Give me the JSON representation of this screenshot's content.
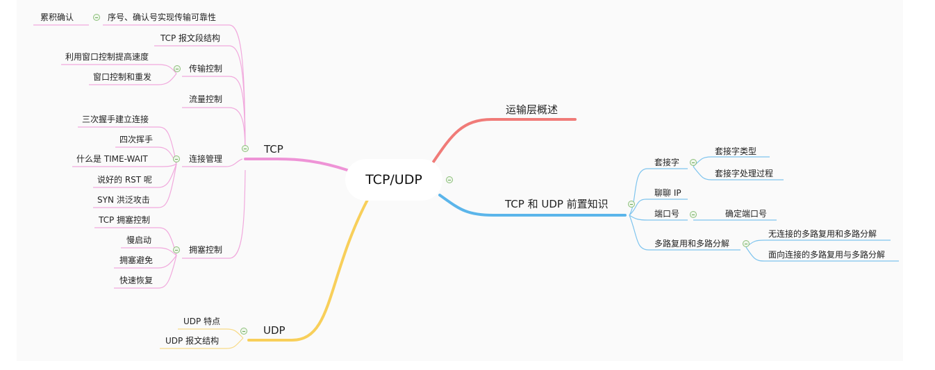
{
  "root": {
    "label": "TCP/UDP"
  },
  "branches": {
    "overview": {
      "label": "运输层概述",
      "color": "#f07b78"
    },
    "prereq": {
      "label": "TCP 和 UDP 前置知识",
      "color": "#5bb5ea",
      "socket": {
        "label": "套接字",
        "children": [
          "套接字类型",
          "套接字处理过程"
        ]
      },
      "ip": {
        "label": "聊聊 IP"
      },
      "port": {
        "label": "端口号",
        "children": [
          "确定端口号"
        ]
      },
      "mux": {
        "label": "多路复用和多路分解",
        "children": [
          "无连接的多路复用和多路分解",
          "面向连接的多路复用与多路分解"
        ]
      }
    },
    "tcp": {
      "label": "TCP",
      "color": "#ee93d6",
      "reliability": {
        "label": "序号、确认号实现传输可靠性",
        "children": [
          "累积确认"
        ]
      },
      "segment": {
        "label": "TCP 报文段结构"
      },
      "transmission": {
        "label": "传输控制",
        "children": [
          "利用窗口控制提高速度",
          "窗口控制和重发"
        ]
      },
      "flow": {
        "label": "流量控制"
      },
      "connection": {
        "label": "连接管理",
        "children": [
          "三次握手建立连接",
          "四次挥手",
          "什么是 TIME-WAIT",
          "说好的 RST 呢",
          "SYN 洪泛攻击"
        ]
      },
      "congestion": {
        "label": "拥塞控制",
        "children": [
          "TCP 拥塞控制",
          "慢启动",
          "拥塞避免",
          "快速恢复"
        ]
      }
    },
    "udp": {
      "label": "UDP",
      "color": "#f8cf5a",
      "children": [
        "UDP 特点",
        "UDP 报文结构"
      ]
    }
  }
}
